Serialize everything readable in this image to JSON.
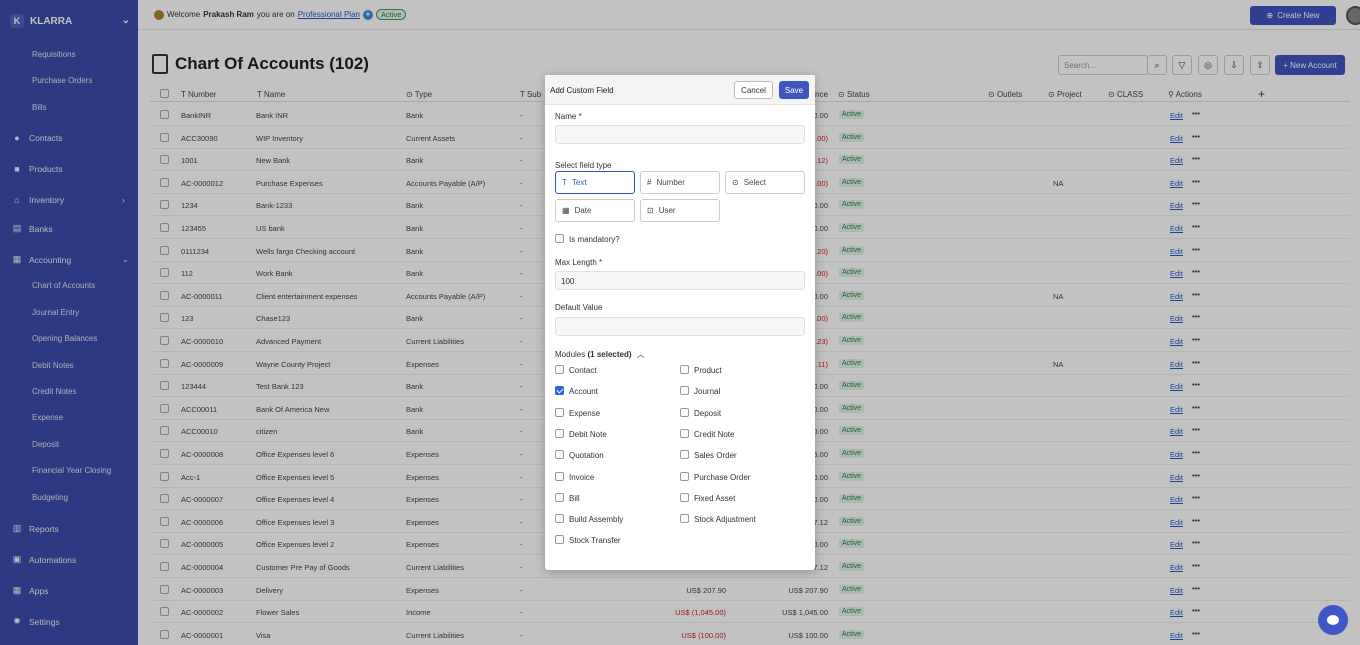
{
  "sidebar": {
    "brand_initial": "K",
    "brand": "KLARRA",
    "items": [
      {
        "label": "Requisitions",
        "level": "sub"
      },
      {
        "label": "Purchase Orders",
        "level": "sub"
      },
      {
        "label": "Bills",
        "level": "sub"
      },
      {
        "label": "Contacts",
        "level": "main",
        "icon": "user-icon"
      },
      {
        "label": "Products",
        "level": "main",
        "icon": "box-icon"
      },
      {
        "label": "Inventory",
        "level": "main",
        "icon": "warehouse-icon"
      },
      {
        "label": "Banks",
        "level": "main",
        "icon": "bank-icon"
      },
      {
        "label": "Accounting",
        "level": "main",
        "icon": "grid-icon"
      },
      {
        "label": "Chart of Accounts",
        "level": "sub"
      },
      {
        "label": "Journal Entry",
        "level": "sub"
      },
      {
        "label": "Opening Balances",
        "level": "sub"
      },
      {
        "label": "Debit Notes",
        "level": "sub"
      },
      {
        "label": "Credit Notes",
        "level": "sub"
      },
      {
        "label": "Expense",
        "level": "sub"
      },
      {
        "label": "Deposit",
        "level": "sub"
      },
      {
        "label": "Financial Year Closing",
        "level": "sub"
      },
      {
        "label": "Budgeting",
        "level": "sub"
      },
      {
        "label": "Reports",
        "level": "main",
        "icon": "chart-icon"
      },
      {
        "label": "Automations",
        "level": "main",
        "icon": "automation-icon"
      },
      {
        "label": "Apps",
        "level": "main",
        "icon": "apps-icon"
      },
      {
        "label": "Settings",
        "level": "main",
        "icon": "gear-icon"
      }
    ]
  },
  "topbar": {
    "welcome": "Welcome",
    "user": "Prakash Ram",
    "you_are_on": "you are on",
    "plan": "Professional Plan",
    "status": "Active",
    "create_new": "Create New"
  },
  "page": {
    "title": "Chart Of Accounts (102)",
    "search_placeholder": "Search...",
    "new_account": "+ New Account"
  },
  "table": {
    "headers": {
      "number": "Number",
      "name": "Name",
      "type": "Type",
      "sub": "Sub",
      "balance": "nce",
      "status": "Status",
      "outlets": "Outlets",
      "project": "Project",
      "class": "CLASS",
      "actions": "Actions"
    },
    "edit_label": "Edit",
    "more_label": "•••",
    "rows": [
      {
        "number": "BankINR",
        "name": "Bank INR",
        "type": "Bank",
        "sub": "-",
        "balance": ".0.00",
        "balance_neg": false,
        "status": "Active",
        "project": ""
      },
      {
        "number": "ACC30090",
        "name": "WIP Inventory",
        "type": "Current Assets",
        "sub": "-",
        "balance": ".00)",
        "balance_neg": true,
        "status": "Active",
        "project": ""
      },
      {
        "number": "1001",
        "name": "New Bank",
        "type": "Bank",
        "sub": "-",
        "balance": ".12)",
        "balance_neg": true,
        "status": "Active",
        "project": ""
      },
      {
        "number": "AC-0000012",
        "name": "Purchase Expenses",
        "type": "Accounts Payable (A/P)",
        "sub": "-",
        "balance": ".00)",
        "balance_neg": true,
        "status": "Active",
        "project": "NA"
      },
      {
        "number": "1234",
        "name": "Bank-1233",
        "type": "Bank",
        "sub": "-",
        "balance": ".0.00",
        "balance_neg": false,
        "status": "Active",
        "project": ""
      },
      {
        "number": "123455",
        "name": "US bank",
        "type": "Bank",
        "sub": "-",
        "balance": ".0.00",
        "balance_neg": false,
        "status": "Active",
        "project": ""
      },
      {
        "number": "0111234",
        "name": "Wells fargo Checking account",
        "type": "Bank",
        "sub": "-",
        "balance": ".20)",
        "balance_neg": true,
        "status": "Active",
        "project": ""
      },
      {
        "number": "112",
        "name": "Work Bank",
        "type": "Bank",
        "sub": "-",
        "balance": ".00)",
        "balance_neg": true,
        "status": "Active",
        "project": ""
      },
      {
        "number": "AC-0000011",
        "name": "Client entertainment expenses",
        "type": "Accounts Payable (A/P)",
        "sub": "-",
        "balance": ".0.00",
        "balance_neg": false,
        "status": "Active",
        "project": "NA"
      },
      {
        "number": "123",
        "name": "Chase123",
        "type": "Bank",
        "sub": "-",
        "balance": ".00)",
        "balance_neg": true,
        "status": "Active",
        "project": ""
      },
      {
        "number": "AC-0000010",
        "name": "Advanced Payment",
        "type": "Current Liabilities",
        "sub": "-",
        "balance": ".23)",
        "balance_neg": true,
        "status": "Active",
        "project": ""
      },
      {
        "number": "AC-0000009",
        "name": "Wayne County Project",
        "type": "Expenses",
        "sub": "-",
        "balance": ".11)",
        "balance_neg": true,
        "status": "Active",
        "project": "NA"
      },
      {
        "number": "123444",
        "name": "Test Bank 123",
        "type": "Bank",
        "sub": "-",
        "balance": ".0.00",
        "balance_neg": false,
        "status": "Active",
        "project": ""
      },
      {
        "number": "ACC00011",
        "name": "Bank Of America New",
        "type": "Bank",
        "sub": "-",
        "balance": ".0.00",
        "balance_neg": false,
        "status": "Active",
        "project": ""
      },
      {
        "number": "ACC00010",
        "name": "citizen",
        "type": "Bank",
        "sub": "-",
        "balance": ".0.00",
        "balance_neg": false,
        "status": "Active",
        "project": ""
      },
      {
        "number": "AC-0000008",
        "name": "Office Expenses level 6",
        "type": "Expenses",
        "sub": "-",
        "balance": ".5.00",
        "balance_neg": false,
        "status": "Active",
        "project": ""
      },
      {
        "number": "Acc-1",
        "name": "Office Expenses level 5",
        "type": "Expenses",
        "sub": "-",
        "balance": ".0.00",
        "balance_neg": false,
        "status": "Active",
        "project": ""
      },
      {
        "number": "AC-0000007",
        "name": "Office Expenses level 4",
        "type": "Expenses",
        "sub": "-",
        "balance": ".0.00",
        "balance_neg": false,
        "status": "Active",
        "project": ""
      },
      {
        "number": "AC-0000006",
        "name": "Office Expenses level 3",
        "type": "Expenses",
        "sub": "-",
        "balance": "7.12",
        "balance_neg": false,
        "status": "Active",
        "project": ""
      },
      {
        "number": "AC-0000005",
        "name": "Office Expenses level 2",
        "type": "Expenses",
        "sub": "-",
        "balance": ".0.00",
        "balance_neg": false,
        "status": "Active",
        "project": ""
      },
      {
        "number": "AC-0000004",
        "name": "Customer Pre Pay of Goods",
        "type": "Current Liabilities",
        "sub": "-",
        "balance": "7.12",
        "balance_neg": false,
        "status": "Active",
        "project": ""
      },
      {
        "number": "AC-0000003",
        "name": "Delivery",
        "type": "Expenses",
        "sub": "-",
        "amount": "US$ 207.90",
        "amount_neg": false,
        "balance": "US$ 207.90",
        "balance_neg": false,
        "status": "Active",
        "project": ""
      },
      {
        "number": "AC-0000002",
        "name": "Flower Sales",
        "type": "Income",
        "sub": "-",
        "amount": "US$ (1,045.00)",
        "amount_neg": true,
        "balance": "US$ 1,045.00",
        "balance_neg": false,
        "status": "Active",
        "project": ""
      },
      {
        "number": "AC-0000001",
        "name": "Visa",
        "type": "Current Liabilities",
        "sub": "-",
        "amount": "US$ (100.00)",
        "amount_neg": true,
        "balance": "US$ 100.00",
        "balance_neg": false,
        "status": "Active",
        "project": ""
      }
    ]
  },
  "modal": {
    "title": "Add Custom Field",
    "cancel": "Cancel",
    "save": "Save",
    "name_label": "Name *",
    "name_value": "",
    "field_type_label": "Select field type",
    "field_types": [
      {
        "label": "Text",
        "glyph": "T",
        "selected": true
      },
      {
        "label": "Number",
        "glyph": "#",
        "selected": false
      },
      {
        "label": "Select",
        "glyph": "⊙",
        "selected": false
      },
      {
        "label": "Date",
        "glyph": "▦",
        "selected": false
      },
      {
        "label": "User",
        "glyph": "⊡",
        "selected": false
      }
    ],
    "mandatory_label": "Is mandatory?",
    "mandatory": false,
    "max_length_label": "Max Length *",
    "max_length_value": "100",
    "default_label": "Default Value",
    "default_value": "",
    "modules_label": "Modules",
    "modules_count": "(1 selected)",
    "modules": [
      {
        "label": "Contact",
        "checked": false
      },
      {
        "label": "Product",
        "checked": false
      },
      {
        "label": "Account",
        "checked": true
      },
      {
        "label": "Journal",
        "checked": false
      },
      {
        "label": "Expense",
        "checked": false
      },
      {
        "label": "Deposit",
        "checked": false
      },
      {
        "label": "Debit Note",
        "checked": false
      },
      {
        "label": "Credit Note",
        "checked": false
      },
      {
        "label": "Quotation",
        "checked": false
      },
      {
        "label": "Sales Order",
        "checked": false
      },
      {
        "label": "Invoice",
        "checked": false
      },
      {
        "label": "Purchase Order",
        "checked": false
      },
      {
        "label": "Bill",
        "checked": false
      },
      {
        "label": "Fixed Asset",
        "checked": false
      },
      {
        "label": "Build Assembly",
        "checked": false
      },
      {
        "label": "Stock Adjustment",
        "checked": false
      },
      {
        "label": "Stock Transfer",
        "checked": false
      }
    ]
  },
  "colors": {
    "sidebar": "#3a4daa",
    "accent": "#3e55c2",
    "active_green": "#2c7d49",
    "negative": "#cc2222"
  }
}
